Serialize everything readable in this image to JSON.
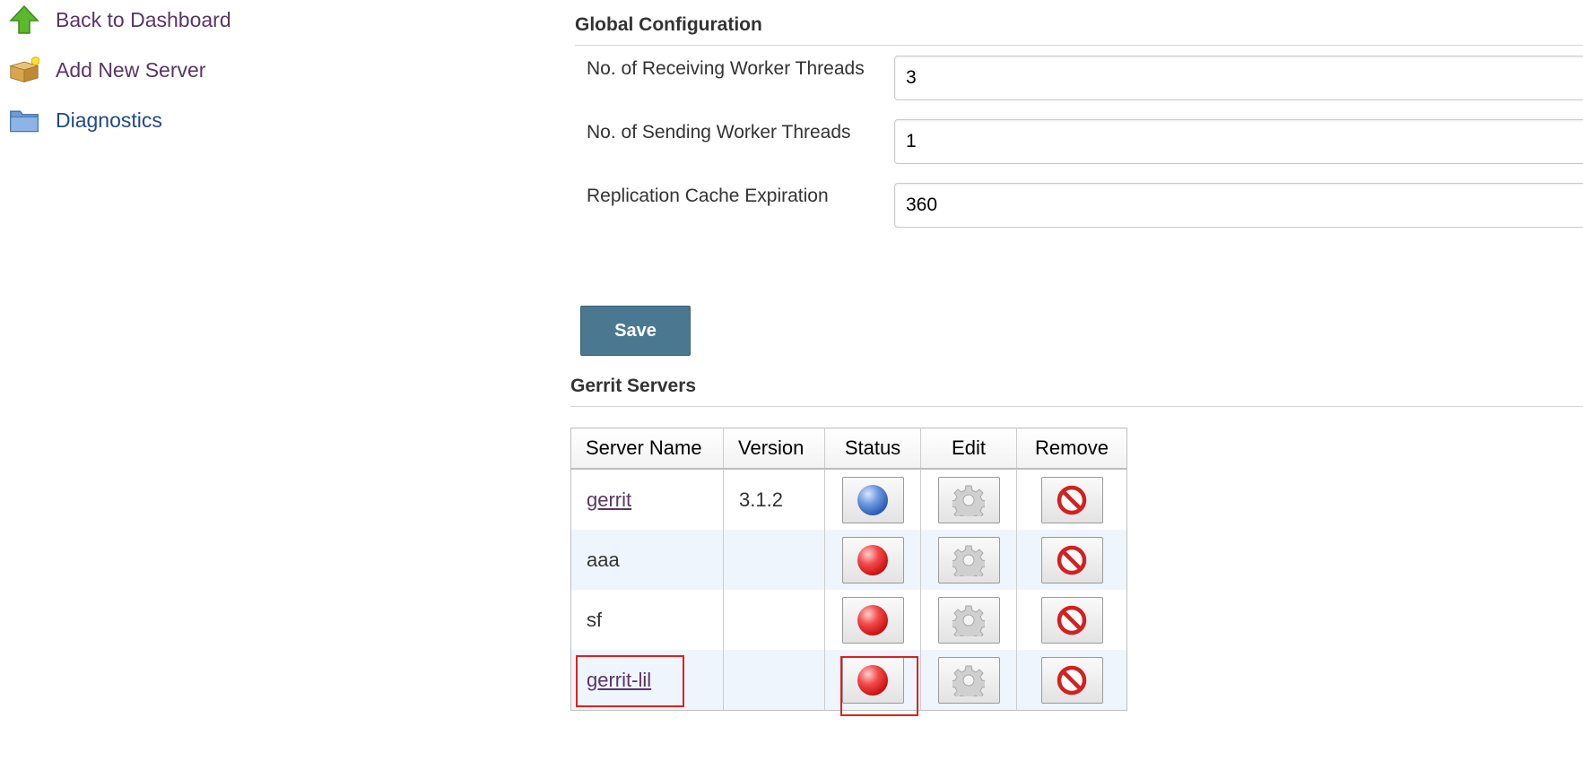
{
  "sidebar": {
    "items": [
      {
        "label": "Back to Dashboard",
        "icon": "up-arrow-icon"
      },
      {
        "label": "Add New Server",
        "icon": "package-icon"
      },
      {
        "label": "Diagnostics",
        "icon": "folder-icon"
      }
    ]
  },
  "global_config": {
    "title": "Global Configuration",
    "fields": [
      {
        "label": "No. of Receiving Worker Threads",
        "value": "3"
      },
      {
        "label": "No. of Sending Worker Threads",
        "value": "1"
      },
      {
        "label": "Replication Cache Expiration",
        "value": "360"
      }
    ],
    "save_label": "Save"
  },
  "servers": {
    "title": "Gerrit Servers",
    "columns": [
      "Server Name",
      "Version",
      "Status",
      "Edit",
      "Remove"
    ],
    "rows": [
      {
        "name": "gerrit",
        "version": "3.1.2",
        "status": "connected",
        "status_color": "#2a58b0",
        "link": true
      },
      {
        "name": "aaa",
        "version": "",
        "status": "disconnected",
        "status_color": "#c90f0f",
        "link": false
      },
      {
        "name": "sf",
        "version": "",
        "status": "disconnected",
        "status_color": "#c90f0f",
        "link": false
      },
      {
        "name": "gerrit-lil",
        "version": "",
        "status": "disconnected",
        "status_color": "#c90f0f",
        "link": true
      }
    ]
  },
  "colors": {
    "save_button": "#4b7891",
    "link": "#5a3566",
    "highlight": "#e02020"
  }
}
